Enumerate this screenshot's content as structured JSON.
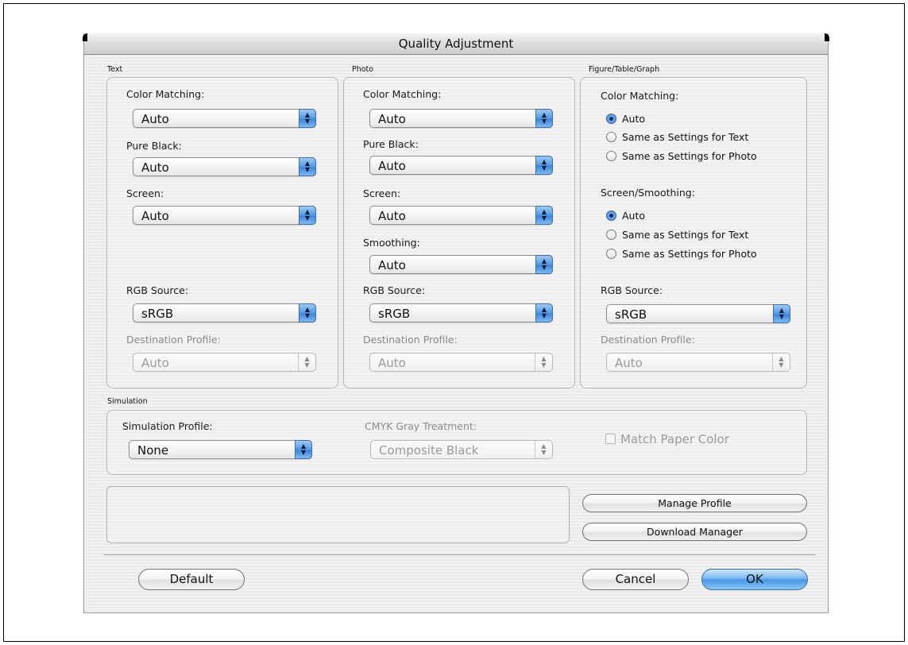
{
  "window": {
    "title": "Quality Adjustment"
  },
  "text_group": {
    "label": "Text",
    "color_matching": {
      "label": "Color Matching:",
      "value": "Auto"
    },
    "pure_black": {
      "label": "Pure Black:",
      "value": "Auto"
    },
    "screen": {
      "label": "Screen:",
      "value": "Auto"
    },
    "rgb_source": {
      "label": "RGB Source:",
      "value": "sRGB"
    },
    "destination_profile": {
      "label": "Destination Profile:",
      "value": "Auto"
    }
  },
  "photo_group": {
    "label": "Photo",
    "color_matching": {
      "label": "Color Matching:",
      "value": "Auto"
    },
    "pure_black": {
      "label": "Pure Black:",
      "value": "Auto"
    },
    "screen": {
      "label": "Screen:",
      "value": "Auto"
    },
    "smoothing": {
      "label": "Smoothing:",
      "value": "Auto"
    },
    "rgb_source": {
      "label": "RGB Source:",
      "value": "sRGB"
    },
    "destination_profile": {
      "label": "Destination Profile:",
      "value": "Auto"
    }
  },
  "figure_group": {
    "label": "Figure/Table/Graph",
    "color_matching": {
      "label": "Color Matching:",
      "options": [
        "Auto",
        "Same as Settings for Text",
        "Same as Settings for Photo"
      ],
      "selected": "Auto"
    },
    "screen_smoothing": {
      "label": "Screen/Smoothing:",
      "options": [
        "Auto",
        "Same as Settings for Text",
        "Same as Settings for Photo"
      ],
      "selected": "Auto"
    },
    "rgb_source": {
      "label": "RGB Source:",
      "value": "sRGB"
    },
    "destination_profile": {
      "label": "Destination Profile:",
      "value": "Auto"
    }
  },
  "simulation": {
    "label": "Simulation",
    "simulation_profile": {
      "label": "Simulation Profile:",
      "value": "None"
    },
    "cmyk_gray": {
      "label": "CMYK Gray Treatment:",
      "value": "Composite Black"
    },
    "match_paper_color": {
      "label": "Match Paper Color",
      "checked": false
    }
  },
  "buttons": {
    "manage_profile": "Manage Profile",
    "download_manager": "Download Manager",
    "default": "Default",
    "cancel": "Cancel",
    "ok": "OK"
  },
  "colors": {
    "accent": "#3b86df",
    "window_bg": "#eeeeee",
    "disabled_text": "#9a9a9a"
  }
}
